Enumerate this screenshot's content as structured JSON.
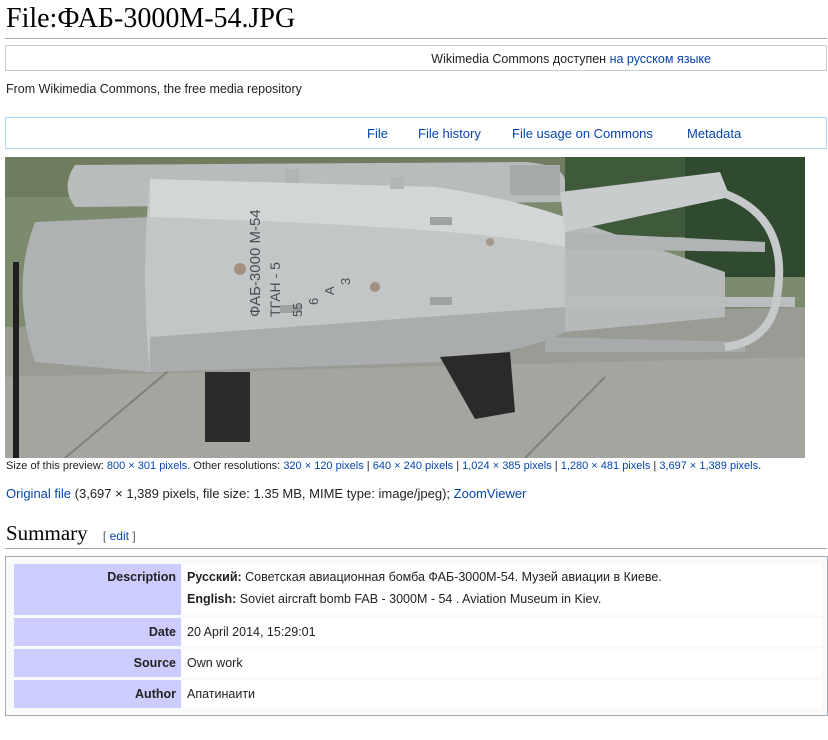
{
  "page": {
    "title": "File:ФАБ-3000М-54.JPG",
    "lang_notice_prefix": "Wikimedia Commons доступен",
    "lang_notice_link": "на русском языке",
    "tagline": "From Wikimedia Commons, the free media repository"
  },
  "file_toc": {
    "items": [
      "File",
      "File history",
      "File usage on Commons",
      "Metadata"
    ]
  },
  "preview": {
    "stencil_line1": "ФАБ-3000 М-54",
    "stencil_line2": "ТГАН - 5",
    "stencil_line3": "55",
    "stencil_line4": "6",
    "stencil_line5": "А",
    "stencil_line6": "3"
  },
  "size_info": {
    "label": "Size of this preview:",
    "preview_size": "800 × 301 pixels",
    "other_label": ". Other resolutions:",
    "resolutions": [
      "320 × 120 pixels",
      "640 × 240 pixels",
      "1,024 × 385 pixels",
      "1,280 × 481 pixels",
      "3,697 × 1,389 pixels"
    ],
    "end": "."
  },
  "original": {
    "link": "Original file",
    "details": "(3,697 × 1,389 pixels, file size: 1.35 MB, MIME type: image/jpeg);",
    "zoom_link": "ZoomViewer"
  },
  "summary": {
    "heading": "Summary",
    "edit_open": "[",
    "edit_link": "edit",
    "edit_close": "]",
    "rows": {
      "description_label": "Description",
      "desc_ru_lang": "Русский:",
      "desc_ru_text": "Советская авиационная бомба ФАБ-3000М-54. Музей авиации в Киеве.",
      "desc_en_lang": "English:",
      "desc_en_text": "Soviet aircraft bomb FAB - 3000M - 54 . Aviation Museum in Kiev.",
      "date_label": "Date",
      "date_value": "20 April 2014, 15:29:01",
      "source_label": "Source",
      "source_value": "Own work",
      "author_label": "Author",
      "author_value": "Апатинаити"
    }
  }
}
